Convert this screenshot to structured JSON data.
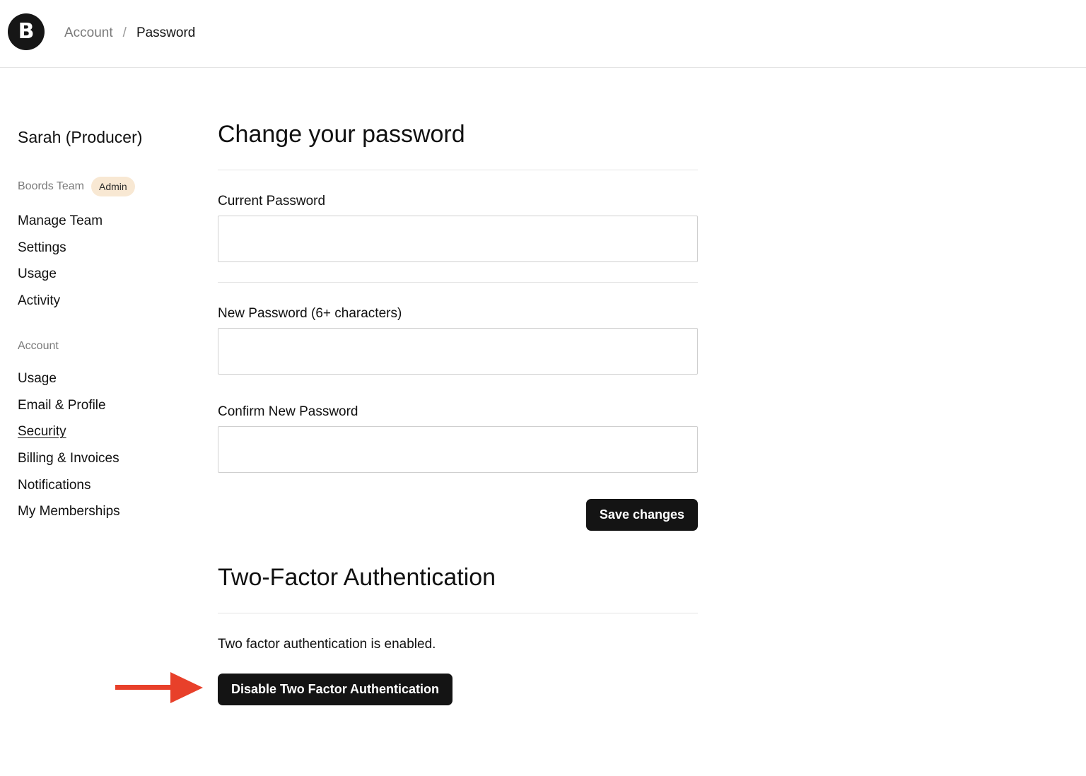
{
  "header": {
    "logo_letter": "B",
    "breadcrumb": {
      "parent": "Account",
      "separator": "/",
      "current": "Password"
    }
  },
  "sidebar": {
    "user_name": "Sarah (Producer)",
    "team": {
      "label": "Boords Team",
      "badge": "Admin",
      "items": [
        "Manage Team",
        "Settings",
        "Usage",
        "Activity"
      ]
    },
    "account": {
      "label": "Account",
      "items": [
        "Usage",
        "Email & Profile",
        "Security",
        "Billing & Invoices",
        "Notifications",
        "My Memberships"
      ],
      "active_item": "Security"
    }
  },
  "password_form": {
    "title": "Change your password",
    "current_label": "Current Password",
    "current_value": "",
    "new_label": "New Password (6+ characters)",
    "new_value": "",
    "confirm_label": "Confirm New Password",
    "confirm_value": "",
    "save_label": "Save changes"
  },
  "two_factor": {
    "title": "Two-Factor Authentication",
    "status": "Two factor authentication is enabled.",
    "disable_label": "Disable Two Factor Authentication"
  },
  "colors": {
    "button_bg": "#141414",
    "badge_bg": "#f8e8d3",
    "arrow": "#e8402a"
  },
  "annotation": {
    "icon": "red-arrow-right-icon"
  }
}
